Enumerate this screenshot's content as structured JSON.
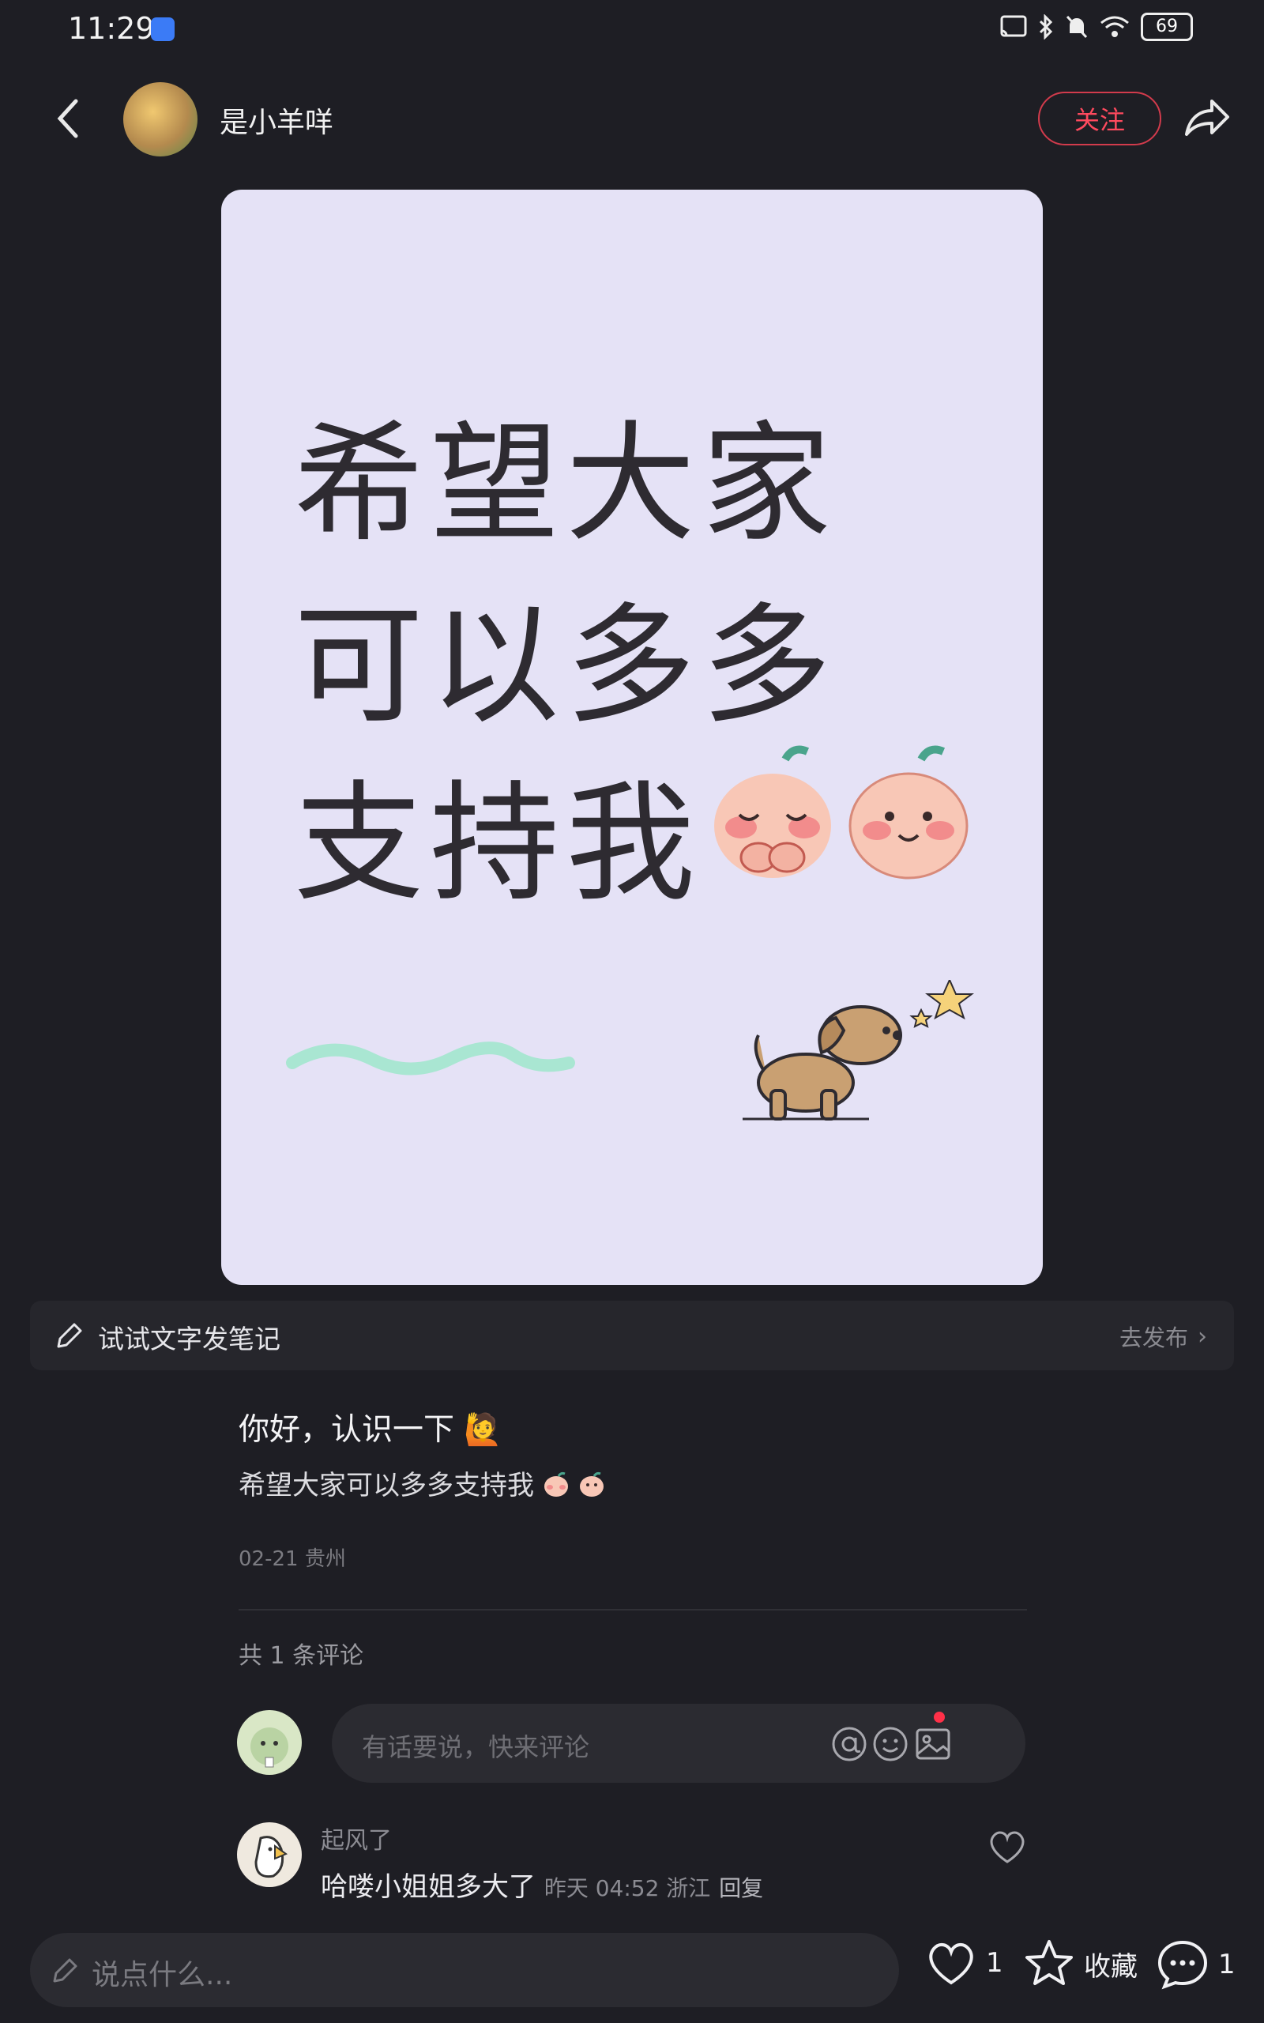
{
  "status": {
    "time": "11:29",
    "battery": "69"
  },
  "header": {
    "author": "是小羊咩",
    "follow_label": "关注"
  },
  "image": {
    "line1": "希望大家",
    "line2": "可以多多",
    "line3": "支持我"
  },
  "try_note": {
    "label": "试试文字发笔记",
    "action": "去发布"
  },
  "post": {
    "title": "你好，认识一下 🙋",
    "desc": "希望大家可以多多支持我",
    "meta": "02-21 贵州"
  },
  "comments": {
    "count_label": "共 1 条评论",
    "input_placeholder": "有话要说，快来评论",
    "items": [
      {
        "user": "起风了",
        "text": "哈喽小姐姐多大了",
        "meta": "昨天 04:52 浙江",
        "reply_label": "回复"
      }
    ]
  },
  "bottom_bar": {
    "placeholder": "说点什么...",
    "like_count": "1",
    "collect_label": "收藏",
    "comment_count": "1"
  },
  "colors": {
    "background": "#1e1e24",
    "card": "#e5e2f6",
    "accent": "#ff4a5e"
  }
}
